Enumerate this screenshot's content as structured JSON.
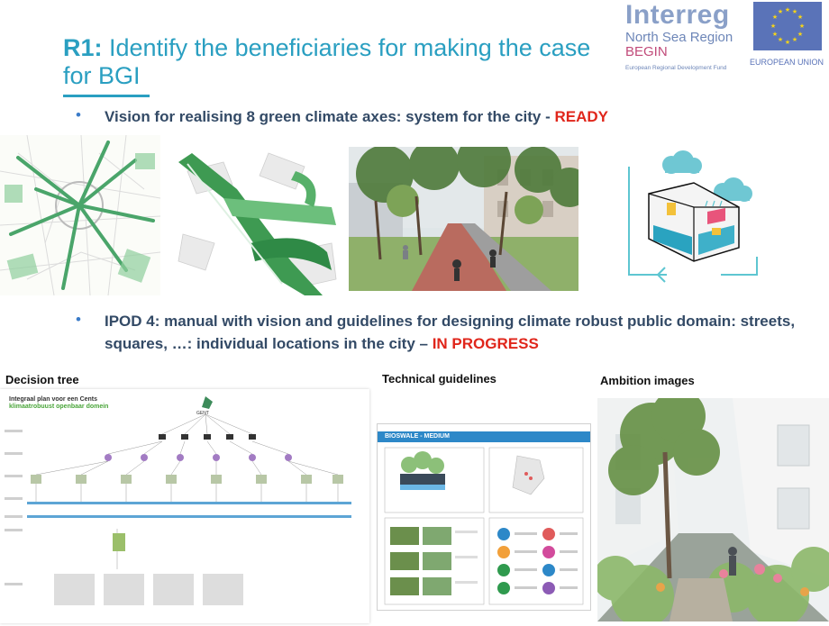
{
  "title": {
    "code": "R1:",
    "text": " Identify the beneficiaries for making the case for BGI"
  },
  "logos": {
    "interreg": "Interreg",
    "region": "North Sea Region",
    "project": "BEGIN",
    "fund": "European Regional Development Fund",
    "eu": "EUROPEAN UNION"
  },
  "bullets": [
    {
      "text": "Vision for realising 8 green climate axes: system for the city - ",
      "status": "READY"
    },
    {
      "text": "IPOD 4: manual with vision and guidelines for designing climate robust public domain: streets, squares, …: individual locations in the city – ",
      "status": "IN PROGRESS"
    }
  ],
  "sections": {
    "decision_tree": "Decision tree",
    "technical_guidelines": "Technical guidelines",
    "ambition_images": "Ambition images"
  },
  "decision_doc": {
    "title_line1": "Integraal plan voor een Cents",
    "title_line2": "klimaatrobuust openbaar domein",
    "root": "GENT"
  },
  "guideline_doc": {
    "header": "BIOSWALE - MEDIUM"
  },
  "colors": {
    "title": "#2a9fc1",
    "status": "#e0261b",
    "bullet_text": "#334a66",
    "accent_blue": "#3a7bc8"
  }
}
